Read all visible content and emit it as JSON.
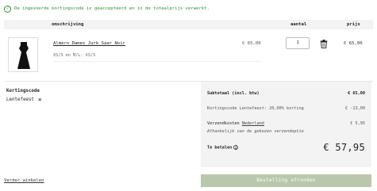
{
  "notice": {
    "text": "De ingevoerde kortingscode is geaccepteerd en in de totaalprijs verwerkt.",
    "icon": "check-circle-icon",
    "color": "#2f8f2f"
  },
  "table": {
    "headers": {
      "description": "omschrijving",
      "quantity": "aantal",
      "price": "prijs"
    }
  },
  "item": {
    "name": "Almero Dames Jurk Saar Noir",
    "variant": "XS/S en M/L: XS/S",
    "unit_price": "€ 65,00",
    "quantity": "1",
    "total": "€ 65,00"
  },
  "coupon": {
    "label": "Kortingscode",
    "code": "Lentefeest"
  },
  "summary": {
    "subtotal_label": "Subtotaal (incl. btw)",
    "subtotal_value": "€ 65,00",
    "discount_label": "Kortingscode Lentefeest: 20,00% korting",
    "discount_value": "€ -13,00",
    "shipping_label": "Verzendkosten",
    "shipping_country": "Nederland",
    "shipping_value": "€ 5,95",
    "shipping_note": "Afhankelijk van de gekozen verzendoptie",
    "total_label": "Te betalen",
    "total_value": "€ 57,95"
  },
  "actions": {
    "checkout": "Bestelling afronden",
    "continue": "Verder winkelen"
  },
  "colors": {
    "checkout_bg": "#b9c7ac",
    "summary_bg": "#f3f3f3"
  }
}
